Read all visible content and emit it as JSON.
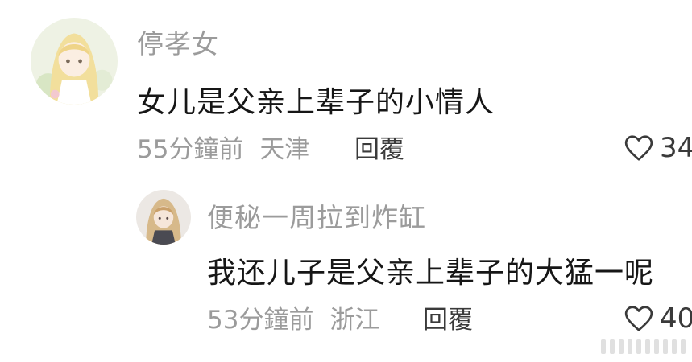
{
  "comments": [
    {
      "username": "停孝女",
      "text": "女儿是父亲上辈子的小情人",
      "time": "55分鐘前",
      "location": "天津",
      "reply_label": "回覆",
      "like_count": "34",
      "avatar_icon": "anime-girl-avatar"
    },
    {
      "username": "便秘一周拉到炸缸",
      "text": "我还儿子是父亲上辈子的大猛一呢",
      "time": "53分鐘前",
      "location": "浙江",
      "reply_label": "回覆",
      "like_count": "40",
      "avatar_icon": "anime-girl-avatar"
    }
  ],
  "colors": {
    "username": "#9b9b9b",
    "text": "#161616",
    "meta": "#9b9b9b",
    "reply": "#3a3a3a"
  },
  "icons": {
    "like": "heart-outline-icon"
  }
}
